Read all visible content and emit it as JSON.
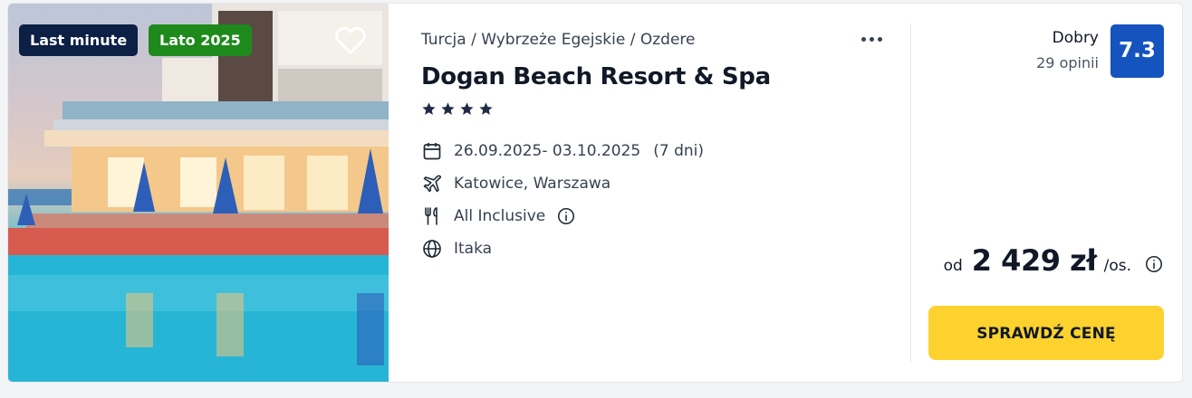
{
  "badges": {
    "last_minute": "Last minute",
    "season": "Lato 2025"
  },
  "colors": {
    "last_minute_bg": "#0c1f45",
    "season_bg": "#1e8a1c",
    "score_bg": "#1553bf",
    "cta_bg": "#fdd22f"
  },
  "offer": {
    "breadcrumb": "Turcja / Wybrzeże Egejskie / Ozdere",
    "hotel_name": "Dogan Beach Resort & Spa",
    "stars": 4,
    "dates": "26.09.2025- 03.10.2025",
    "duration": "(7 dni)",
    "departure": "Katowice, Warszawa",
    "board": "All Inclusive",
    "operator": "Itaka"
  },
  "rating": {
    "label": "Dobry",
    "count": "29 opinii",
    "score": "7.3"
  },
  "price": {
    "prefix": "od",
    "amount": "2 429 zł",
    "suffix": "/os."
  },
  "cta_label": "SPRAWDŹ CENĘ",
  "icons": [
    "heart-icon",
    "more-icon",
    "star-icon",
    "calendar-icon",
    "plane-icon",
    "cutlery-icon",
    "info-icon",
    "globe-icon"
  ]
}
